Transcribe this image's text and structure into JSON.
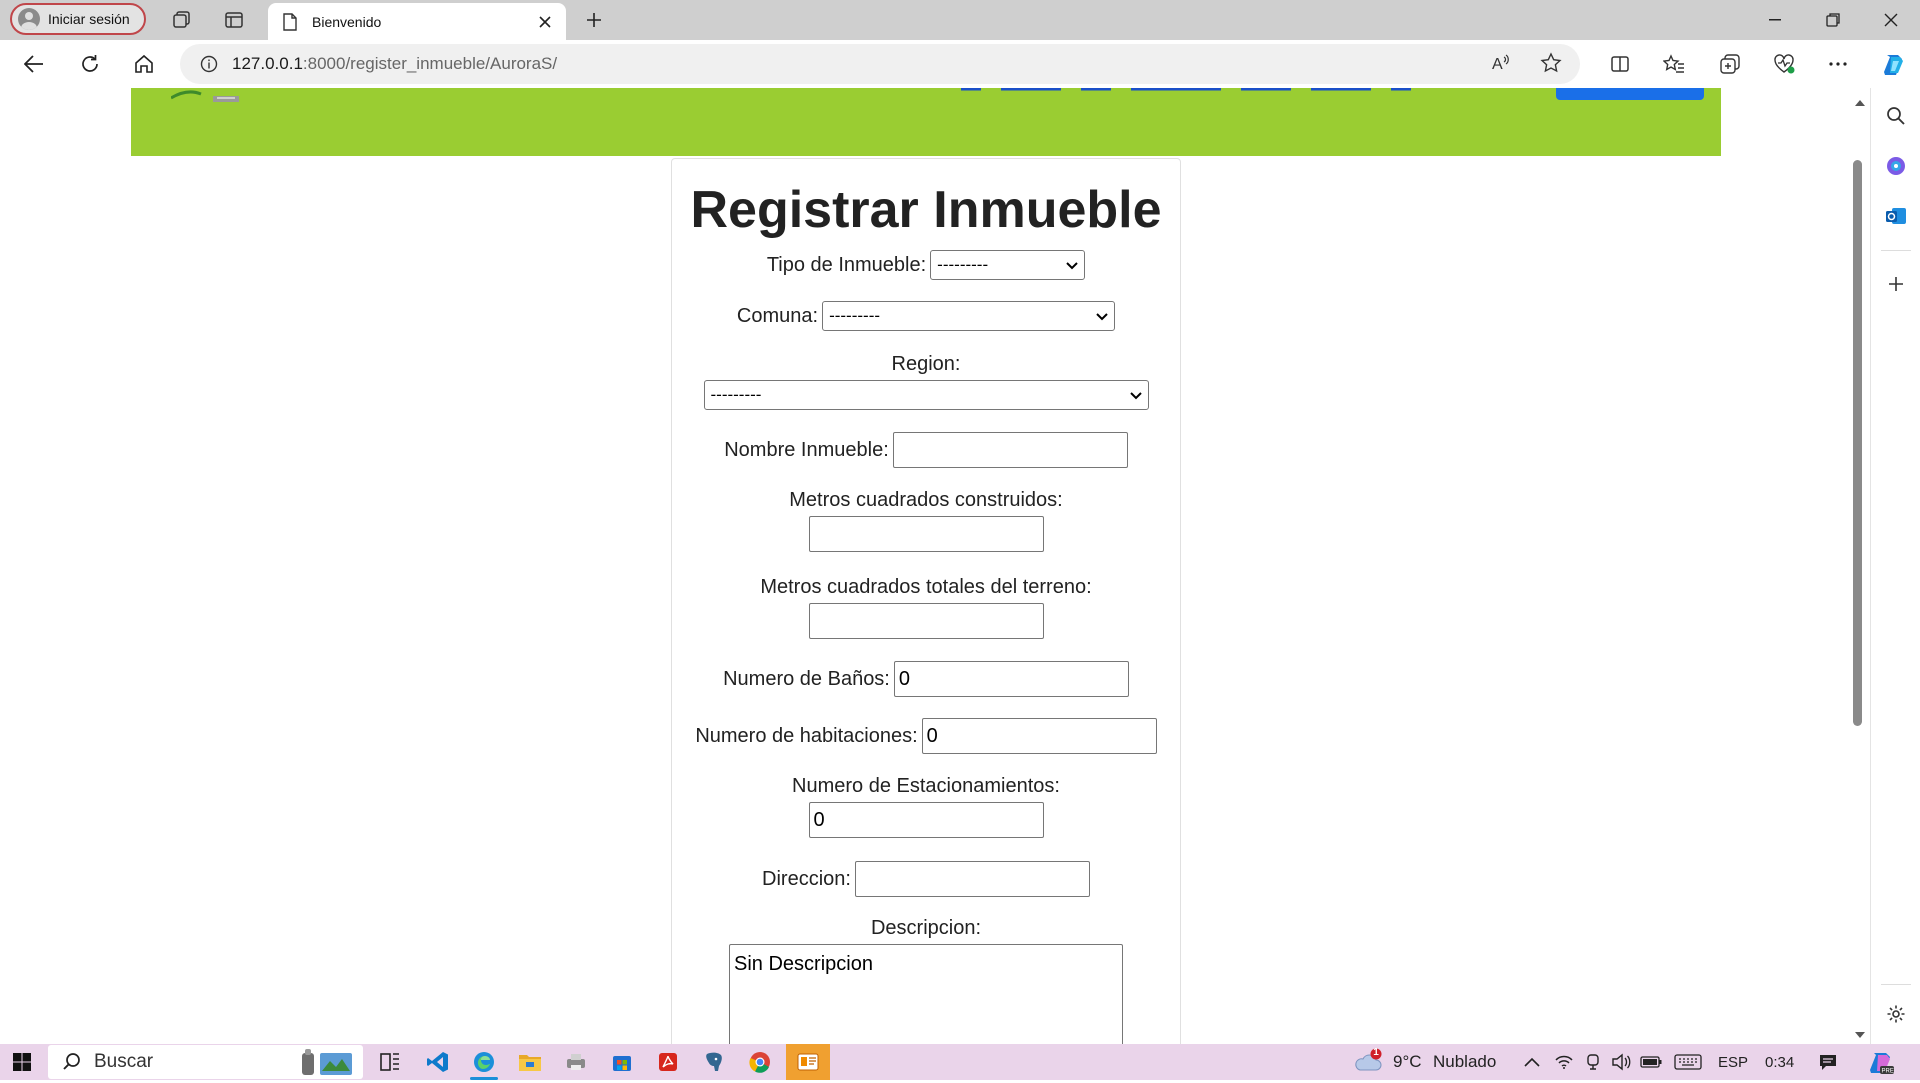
{
  "browser": {
    "profile_label": "Iniciar sesión",
    "tab_title": "Bienvenido",
    "url_host": "127.0.0.1",
    "url_rest": ":8000/register_inmueble/AuroraS/"
  },
  "form": {
    "title": "Registrar Inmueble",
    "tipo_label": "Tipo de Inmueble:",
    "tipo_value": "---------",
    "comuna_label": "Comuna:",
    "comuna_value": "---------",
    "region_label": "Region:",
    "region_value": "---------",
    "nombre_label": "Nombre Inmueble:",
    "nombre_value": "",
    "m2_construidos_label": "Metros cuadrados construidos:",
    "m2_construidos_value": "",
    "m2_terreno_label": "Metros cuadrados totales del terreno:",
    "m2_terreno_value": "",
    "banos_label": "Numero de Baños:",
    "banos_value": "0",
    "habitaciones_label": "Numero de habitaciones:",
    "habitaciones_value": "0",
    "estacionamientos_label": "Numero de Estacionamientos:",
    "estacionamientos_value": "0",
    "direccion_label": "Direccion:",
    "direccion_value": "",
    "descripcion_label": "Descripcion:",
    "descripcion_value": "Sin Descripcion"
  },
  "taskbar": {
    "search_label": "Buscar",
    "weather_temp": "9°C",
    "weather_desc": "Nublado",
    "weather_badge": "1",
    "language": "ESP",
    "time": "0:34"
  },
  "colors": {
    "banner_green": "#9acd32",
    "banner_button": "#1a6fe8",
    "profile_border": "#c0464a",
    "taskbar_bg": "#ead4ea"
  }
}
